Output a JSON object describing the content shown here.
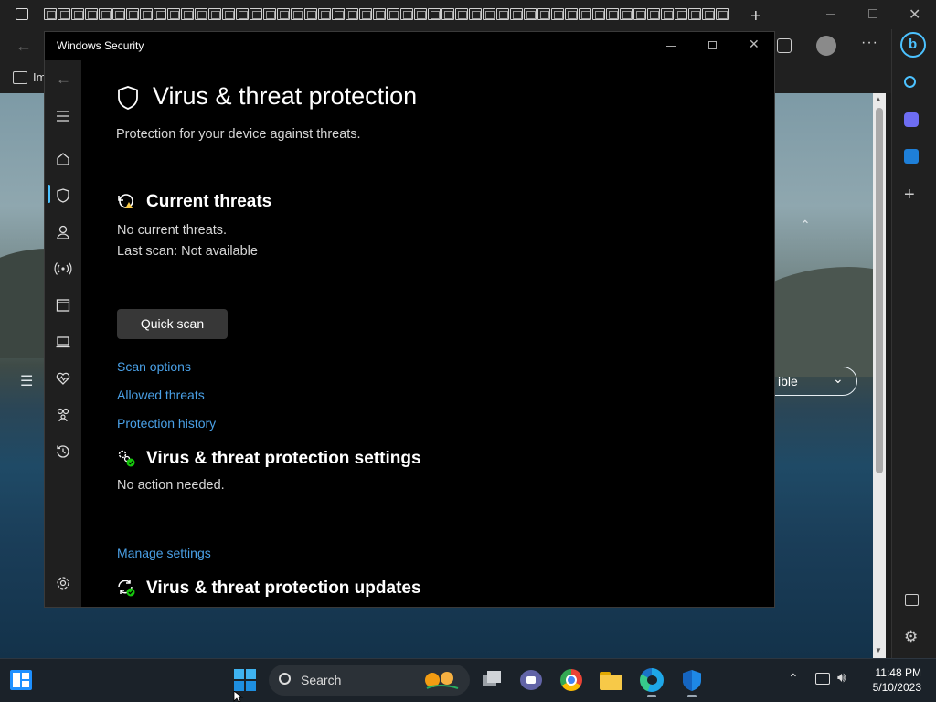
{
  "browser": {
    "tab_count": 50,
    "favorites_label": "Im",
    "webpage_dropdown_text": "ible"
  },
  "window": {
    "title": "Windows Security"
  },
  "page": {
    "title": "Virus & threat protection",
    "subtitle": "Protection for your device against threats."
  },
  "current_threats": {
    "heading": "Current threats",
    "status": "No current threats.",
    "last_scan": "Last scan: Not available",
    "quick_scan_label": "Quick scan",
    "links": [
      "Scan options",
      "Allowed threats",
      "Protection history"
    ]
  },
  "settings_section": {
    "heading": "Virus & threat protection settings",
    "status": "No action needed.",
    "link": "Manage settings"
  },
  "updates_section": {
    "heading": "Virus & threat protection updates"
  },
  "taskbar": {
    "search_placeholder": "Search",
    "time": "11:48 PM",
    "date": "5/10/2023"
  },
  "colors": {
    "link": "#4aa0e6",
    "accent": "#4cc2ff",
    "ok_green": "#16c60c"
  }
}
